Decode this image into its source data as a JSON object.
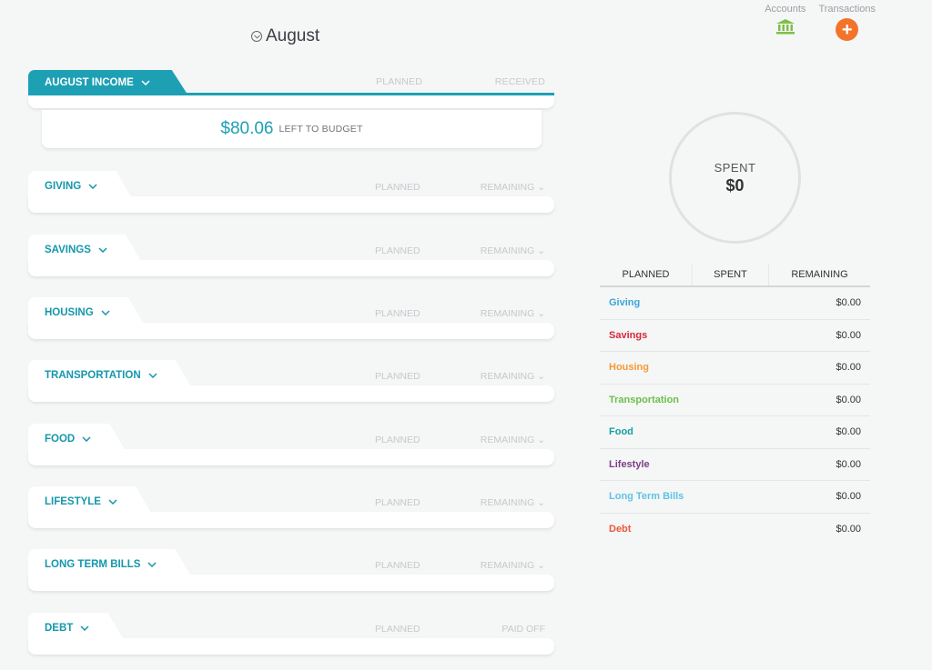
{
  "header": {
    "month": "August"
  },
  "topnav": {
    "accounts": "Accounts",
    "transactions": "Transactions",
    "plus": "+"
  },
  "income": {
    "title": "AUGUST INCOME",
    "col1": "PLANNED",
    "col2": "RECEIVED",
    "left_amount": "$80.06",
    "left_label": "LEFT TO BUDGET"
  },
  "categories": [
    {
      "title": "GIVING",
      "planned": "PLANNED",
      "remaining": "REMAINING ⌄"
    },
    {
      "title": "SAVINGS",
      "planned": "PLANNED",
      "remaining": "REMAINING ⌄"
    },
    {
      "title": "HOUSING",
      "planned": "PLANNED",
      "remaining": "REMAINING ⌄"
    },
    {
      "title": "TRANSPORTATION",
      "planned": "PLANNED",
      "remaining": "REMAINING ⌄"
    },
    {
      "title": "FOOD",
      "planned": "PLANNED",
      "remaining": "REMAINING ⌄"
    },
    {
      "title": "LIFESTYLE",
      "planned": "PLANNED",
      "remaining": "REMAINING ⌄"
    },
    {
      "title": "LONG TERM BILLS",
      "planned": "PLANNED",
      "remaining": "REMAINING ⌄"
    },
    {
      "title": "DEBT",
      "planned": "PLANNED",
      "remaining": "PAID OFF"
    }
  ],
  "spent": {
    "label": "SPENT",
    "value": "$0"
  },
  "summary": {
    "headers": [
      "PLANNED",
      "SPENT",
      "REMAINING"
    ],
    "rows": [
      {
        "name": "Giving",
        "amount": "$0.00",
        "color": "#3aa6d8"
      },
      {
        "name": "Savings",
        "amount": "$0.00",
        "color": "#d6283a"
      },
      {
        "name": "Housing",
        "amount": "$0.00",
        "color": "#f39a3a"
      },
      {
        "name": "Transportation",
        "amount": "$0.00",
        "color": "#6cc04a"
      },
      {
        "name": "Food",
        "amount": "$0.00",
        "color": "#14a0a0"
      },
      {
        "name": "Lifestyle",
        "amount": "$0.00",
        "color": "#7b3f86"
      },
      {
        "name": "Long Term Bills",
        "amount": "$0.00",
        "color": "#5fc3e6"
      },
      {
        "name": "Debt",
        "amount": "$0.00",
        "color": "#e8583a"
      }
    ]
  },
  "colors": {
    "accent": "#1da0b4",
    "orange": "#f2742a",
    "bank": "#7ebf4b"
  }
}
